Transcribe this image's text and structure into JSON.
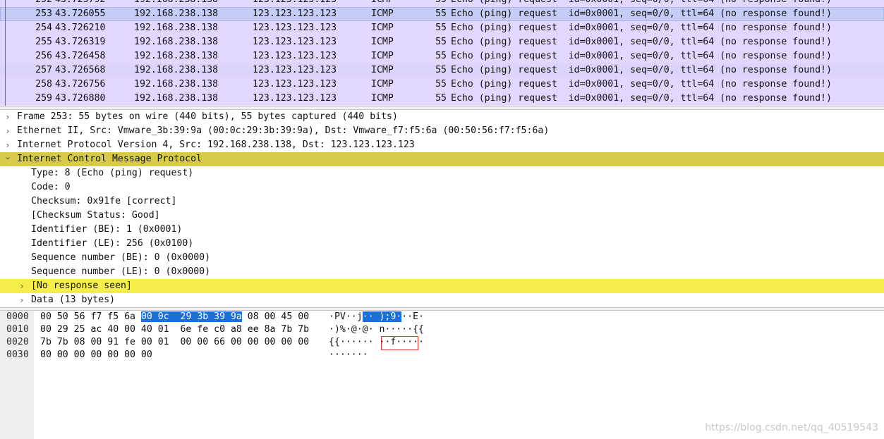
{
  "packet_list": {
    "row_color": "#e4d7ff",
    "selected_color": "#c5cdf6",
    "hover_color": "#dcd4fa",
    "rows": [
      {
        "no": "252",
        "time": "43.725792",
        "src": "192.168.238.138",
        "dst": "123.123.123.123",
        "proto": "ICMP",
        "len": "55",
        "info": "Echo (ping) request  id=0x0001, seq=0/0, ttl=64 (no response found!)",
        "state": "normal"
      },
      {
        "no": "253",
        "time": "43.726055",
        "src": "192.168.238.138",
        "dst": "123.123.123.123",
        "proto": "ICMP",
        "len": "55",
        "info": "Echo (ping) request  id=0x0001, seq=0/0, ttl=64 (no response found!)",
        "state": "selected"
      },
      {
        "no": "254",
        "time": "43.726210",
        "src": "192.168.238.138",
        "dst": "123.123.123.123",
        "proto": "ICMP",
        "len": "55",
        "info": "Echo (ping) request  id=0x0001, seq=0/0, ttl=64 (no response found!)",
        "state": "normal"
      },
      {
        "no": "255",
        "time": "43.726319",
        "src": "192.168.238.138",
        "dst": "123.123.123.123",
        "proto": "ICMP",
        "len": "55",
        "info": "Echo (ping) request  id=0x0001, seq=0/0, ttl=64 (no response found!)",
        "state": "normal"
      },
      {
        "no": "256",
        "time": "43.726458",
        "src": "192.168.238.138",
        "dst": "123.123.123.123",
        "proto": "ICMP",
        "len": "55",
        "info": "Echo (ping) request  id=0x0001, seq=0/0, ttl=64 (no response found!)",
        "state": "normal"
      },
      {
        "no": "257",
        "time": "43.726568",
        "src": "192.168.238.138",
        "dst": "123.123.123.123",
        "proto": "ICMP",
        "len": "55",
        "info": "Echo (ping) request  id=0x0001, seq=0/0, ttl=64 (no response found!)",
        "state": "hover"
      },
      {
        "no": "258",
        "time": "43.726756",
        "src": "192.168.238.138",
        "dst": "123.123.123.123",
        "proto": "ICMP",
        "len": "55",
        "info": "Echo (ping) request  id=0x0001, seq=0/0, ttl=64 (no response found!)",
        "state": "normal"
      },
      {
        "no": "259",
        "time": "43.726880",
        "src": "192.168.238.138",
        "dst": "123.123.123.123",
        "proto": "ICMP",
        "len": "55",
        "info": "Echo (ping) request  id=0x0001, seq=0/0, ttl=64 (no response found!)",
        "state": "normal"
      }
    ]
  },
  "details": {
    "selected_color": "#d7cc4a",
    "highlight_color": "#f5ee4a",
    "rows": [
      {
        "text": "Frame 253: 55 bytes on wire (440 bits), 55 bytes captured (440 bits)",
        "level": 0,
        "arrow": "collapsed",
        "style": "normal"
      },
      {
        "text": "Ethernet II, Src: Vmware_3b:39:9a (00:0c:29:3b:39:9a), Dst: Vmware_f7:f5:6a (00:50:56:f7:f5:6a)",
        "level": 0,
        "arrow": "collapsed",
        "style": "normal"
      },
      {
        "text": "Internet Protocol Version 4, Src: 192.168.238.138, Dst: 123.123.123.123",
        "level": 0,
        "arrow": "collapsed",
        "style": "normal"
      },
      {
        "text": "Internet Control Message Protocol",
        "level": 0,
        "arrow": "expanded",
        "style": "selected"
      },
      {
        "text": "Type: 8 (Echo (ping) request)",
        "level": 1,
        "arrow": "none",
        "style": "normal"
      },
      {
        "text": "Code: 0",
        "level": 1,
        "arrow": "none",
        "style": "normal"
      },
      {
        "text": "Checksum: 0x91fe [correct]",
        "level": 1,
        "arrow": "none",
        "style": "normal"
      },
      {
        "text": "[Checksum Status: Good]",
        "level": 1,
        "arrow": "none",
        "style": "normal"
      },
      {
        "text": "Identifier (BE): 1 (0x0001)",
        "level": 1,
        "arrow": "none",
        "style": "normal"
      },
      {
        "text": "Identifier (LE): 256 (0x0100)",
        "level": 1,
        "arrow": "none",
        "style": "normal"
      },
      {
        "text": "Sequence number (BE): 0 (0x0000)",
        "level": 1,
        "arrow": "none",
        "style": "normal"
      },
      {
        "text": "Sequence number (LE): 0 (0x0000)",
        "level": 1,
        "arrow": "none",
        "style": "normal"
      },
      {
        "text": "[No response seen]",
        "level": 1,
        "arrow": "collapsed",
        "style": "highlight"
      },
      {
        "text": "Data (13 bytes)",
        "level": 1,
        "arrow": "collapsed",
        "style": "normal"
      }
    ]
  },
  "bytes": {
    "rows": [
      {
        "offset": "0000",
        "hex": [
          {
            "t": "00 50 56 f7 f5 6a ",
            "hl": false
          },
          {
            "t": "00 0c  29 3b 39 9a",
            "hl": true
          },
          {
            "t": " 08 00 45 00",
            "hl": false
          }
        ],
        "ascii": [
          {
            "t": "·PV··j",
            "hl": false
          },
          {
            "t": "·· );9·",
            "hl": true
          },
          {
            "t": "··E·",
            "hl": false
          }
        ]
      },
      {
        "offset": "0010",
        "hex": [
          {
            "t": "00 29 25 ac 40 00 40 01  6e fe c0 a8 ee 8a 7b 7b",
            "hl": false
          }
        ],
        "ascii": [
          {
            "t": "·)%·@·@· n·····{{",
            "hl": false
          }
        ]
      },
      {
        "offset": "0020",
        "hex": [
          {
            "t": "7b 7b 08 00 91 fe 00 01  00 00 66 00 00 00 00 00",
            "hl": false
          }
        ],
        "ascii": [
          {
            "t": "{{······ ··f·····",
            "hl": false
          }
        ]
      },
      {
        "offset": "0030",
        "hex": [
          {
            "t": "00 00 00 00 00 00 00",
            "hl": false
          }
        ],
        "ascii": [
          {
            "t": "·······",
            "hl": false
          }
        ]
      }
    ]
  },
  "watermark": "https://blog.csdn.net/qq_40519543"
}
